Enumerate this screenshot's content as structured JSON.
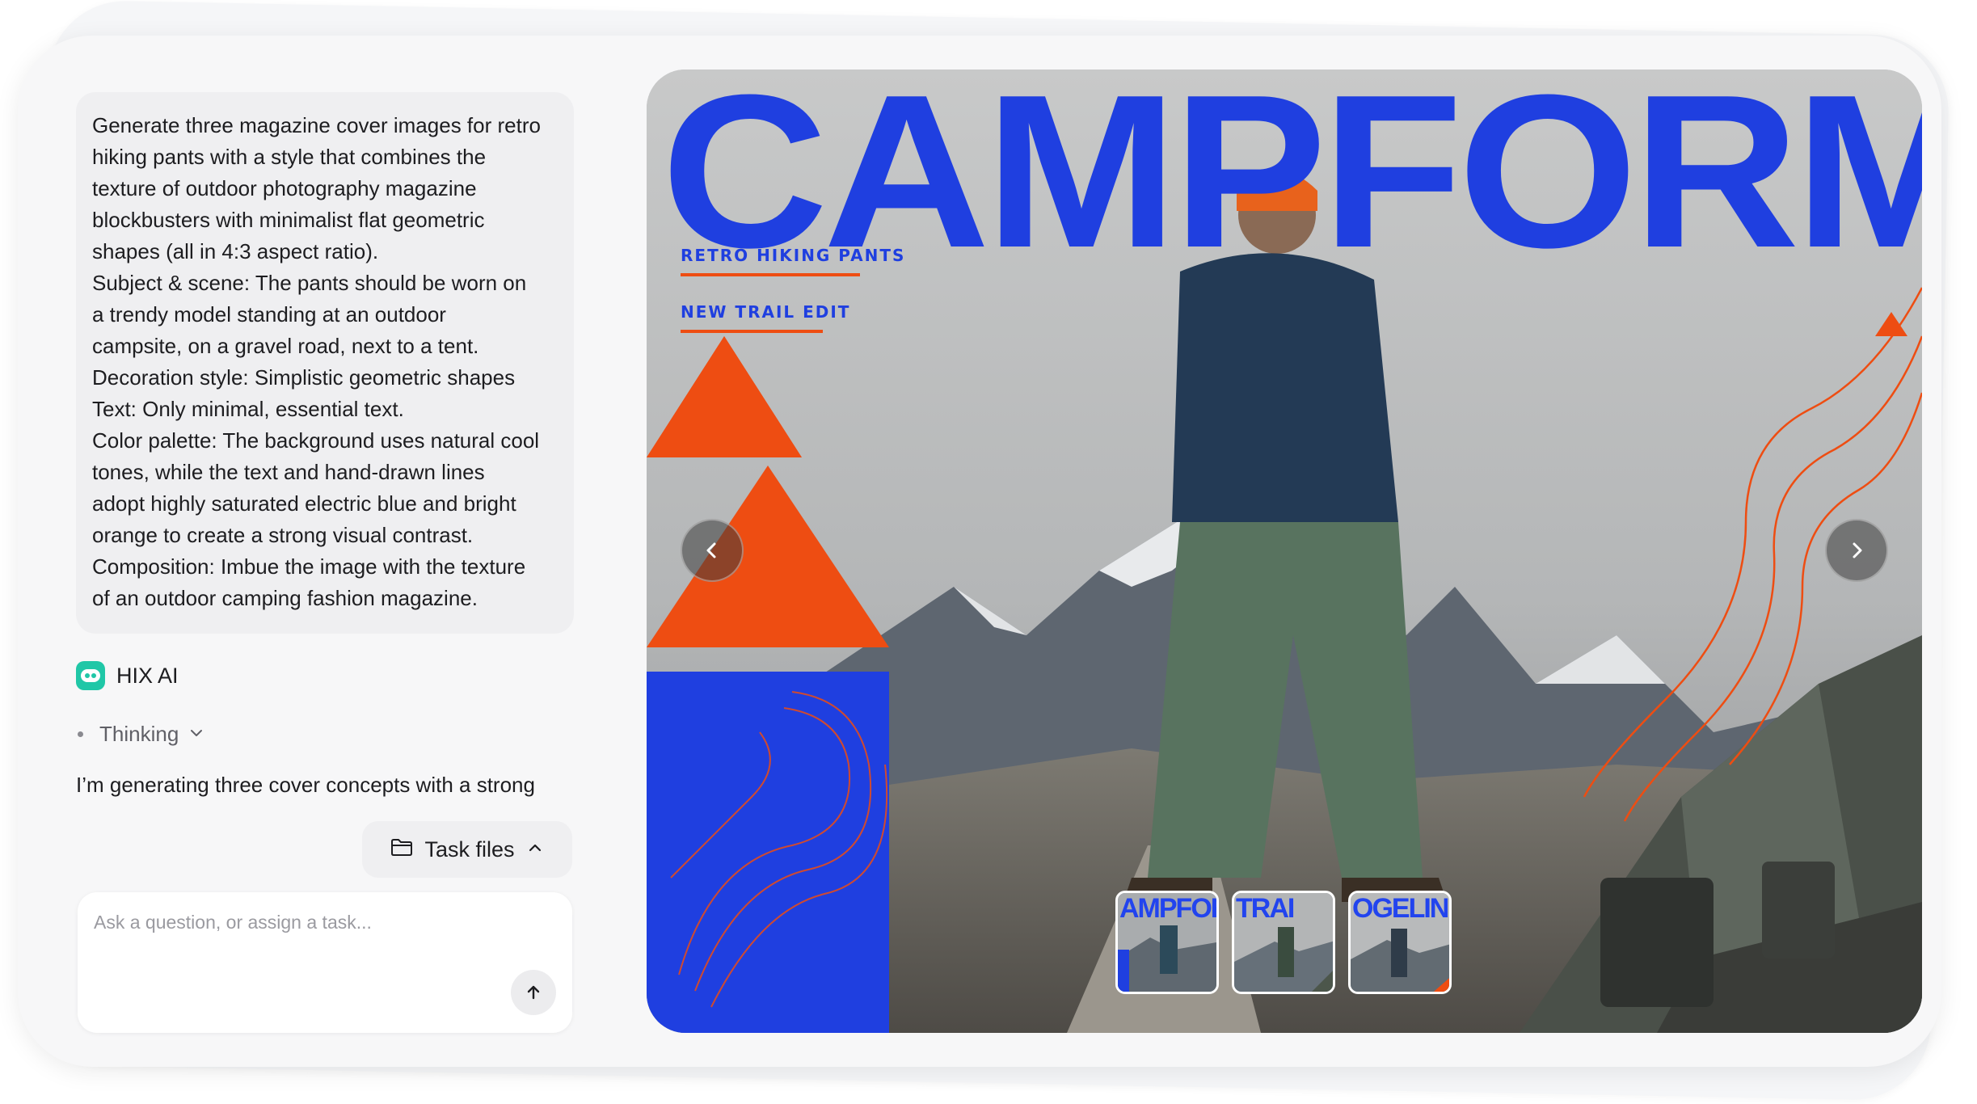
{
  "prompt": {
    "lines": [
      "Generate three magazine cover images for retro",
      "hiking pants with a style that combines the",
      "texture of outdoor photography magazine",
      "blockbusters with minimalist flat geometric",
      "shapes (all in 4:3 aspect ratio).",
      "Subject & scene: The pants should be worn on",
      "a trendy model standing at an outdoor",
      "campsite, on a gravel road, next to a tent.",
      "Decoration style: Simplistic geometric shapes",
      "Text: Only minimal, essential text.",
      "Color palette: The background uses natural cool",
      "tones, while the text and hand-drawn lines",
      "adopt highly saturated electric blue and bright",
      "orange to create a strong visual contrast.",
      "Composition: Imbue the image with the texture",
      "of an outdoor camping fashion magazine."
    ]
  },
  "assistant": {
    "name": "HIX AI",
    "logo_icon": "hix-ai-logo-icon",
    "thinking_label": "Thinking",
    "response_text": "I’m generating three cover concepts with a strong"
  },
  "task_files": {
    "label": "Task files",
    "icon": "folder-icon"
  },
  "composer": {
    "placeholder": "Ask a question, or assign a task...",
    "send_icon": "arrow-up-icon"
  },
  "cover": {
    "masthead": "CAMPFORM",
    "tag1": "RETRO HIKING PANTS",
    "tag2": "NEW TRAIL EDIT",
    "prev_icon": "chevron-left-icon",
    "next_icon": "chevron-right-icon"
  },
  "thumbnails": [
    {
      "text": "AMPFORI"
    },
    {
      "text": "TRAI"
    },
    {
      "text": "OGELINE"
    }
  ],
  "colors": {
    "accent_blue": "#1f3fe0",
    "accent_orange": "#ee4d12",
    "logo_teal": "#20c7a7"
  }
}
